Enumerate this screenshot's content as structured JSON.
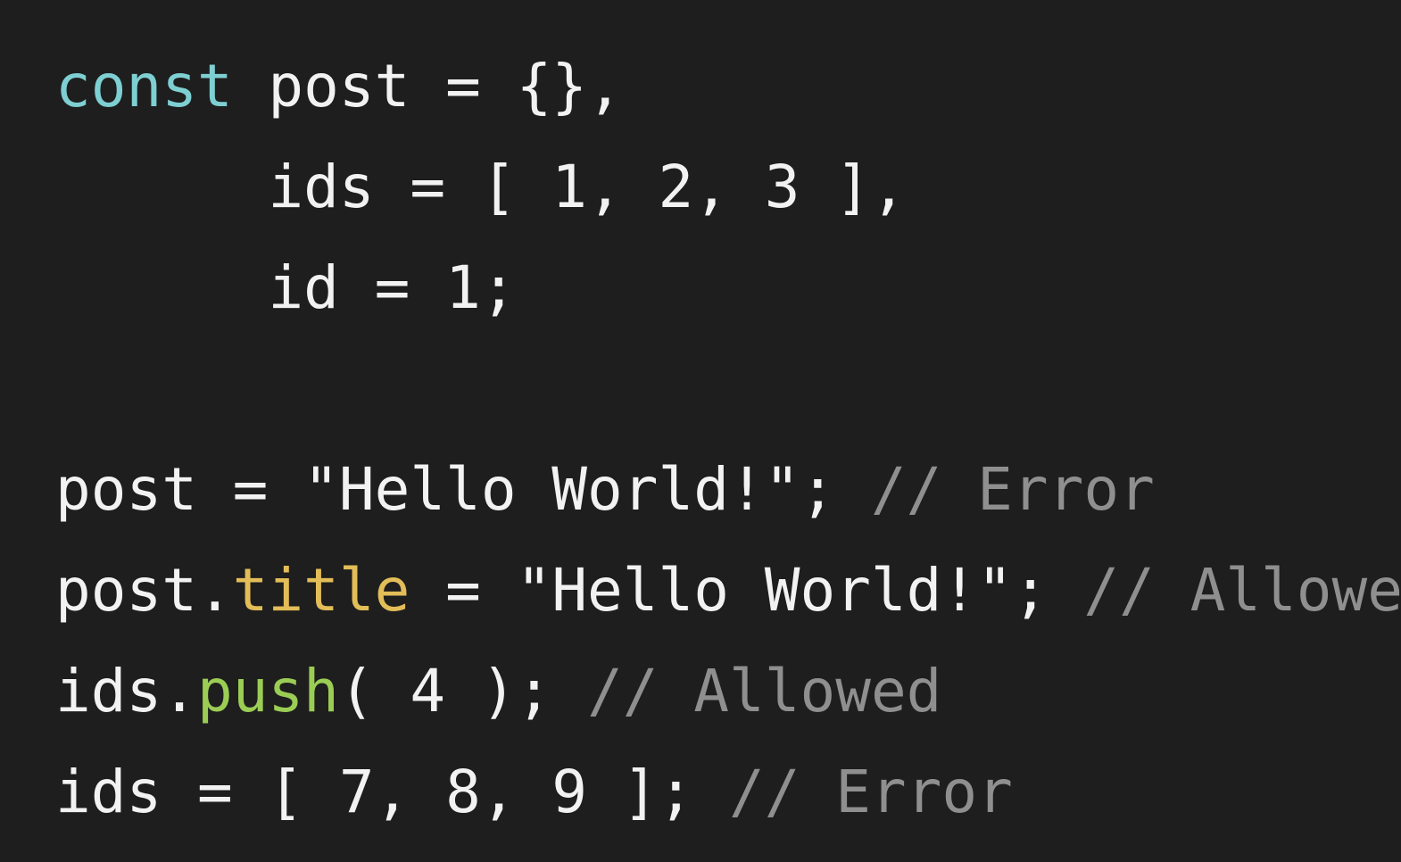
{
  "colors": {
    "background": "#1e1e1e",
    "text": "#f2f2f2",
    "keyword": "#7ecfd2",
    "property": "#e2bd58",
    "method": "#9bcd55",
    "comment": "#8f8f8f"
  },
  "code": {
    "lines": [
      [
        {
          "text": "const",
          "kind": "keyword"
        },
        {
          "text": " post = {},",
          "kind": "text"
        }
      ],
      [
        {
          "text": "      ids = [ 1, 2, 3 ],",
          "kind": "text"
        }
      ],
      [
        {
          "text": "      id = 1;",
          "kind": "text"
        }
      ],
      [],
      [
        {
          "text": "post = \"Hello World!\"; ",
          "kind": "text"
        },
        {
          "text": "// Error",
          "kind": "comment"
        }
      ],
      [
        {
          "text": "post.",
          "kind": "text"
        },
        {
          "text": "title",
          "kind": "property"
        },
        {
          "text": " = \"Hello World!\"; ",
          "kind": "text"
        },
        {
          "text": "// Allowed",
          "kind": "comment"
        }
      ],
      [
        {
          "text": "ids.",
          "kind": "text"
        },
        {
          "text": "push",
          "kind": "method"
        },
        {
          "text": "( 4 ); ",
          "kind": "text"
        },
        {
          "text": "// Allowed",
          "kind": "comment"
        }
      ],
      [
        {
          "text": "ids = [ 7, 8, 9 ]; ",
          "kind": "text"
        },
        {
          "text": "// Error",
          "kind": "comment"
        }
      ]
    ]
  }
}
